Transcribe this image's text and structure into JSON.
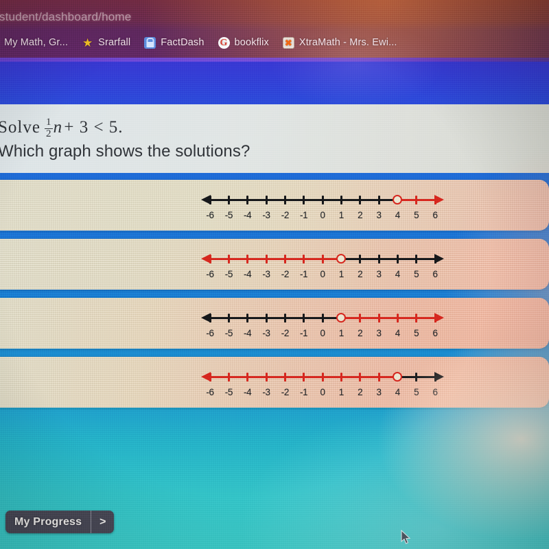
{
  "browser": {
    "url_text": "/student/dashboard/home",
    "bookmarks": [
      {
        "label": "My Math, Gr...",
        "icon": "none"
      },
      {
        "label": "Srarfall",
        "icon": "star-icon"
      },
      {
        "label": "FactDash",
        "icon": "lock-icon"
      },
      {
        "label": "bookflix",
        "icon": "google-g-icon"
      },
      {
        "label": "XtraMath - Mrs. Ewi...",
        "icon": "x-icon"
      }
    ]
  },
  "question": {
    "prefix": "Solve",
    "fraction_numerator": "1",
    "fraction_denominator": "2",
    "variable": "n",
    "rest": "+ 3 < 5.",
    "full_equation": "Solve 1/2 n + 3 < 5.",
    "prompt": "Which graph shows the solutions?"
  },
  "number_line": {
    "min": -6,
    "max": 6,
    "tick_labels": [
      "-6",
      "-5",
      "-4",
      "-3",
      "-2",
      "-1",
      "0",
      "1",
      "2",
      "3",
      "4",
      "5",
      "6"
    ],
    "colors": {
      "black": "#16181b",
      "red": "#d7281f"
    }
  },
  "options": [
    {
      "id": "A",
      "open_circle_at": 4,
      "shaded_direction": "right",
      "shaded_color": "#d7281f",
      "unshaded_color": "#16181b",
      "left_arrow_color": "#16181b",
      "right_arrow_color": "#d7281f"
    },
    {
      "id": "B",
      "open_circle_at": 1,
      "shaded_direction": "left",
      "shaded_color": "#d7281f",
      "unshaded_color": "#16181b",
      "left_arrow_color": "#d7281f",
      "right_arrow_color": "#16181b"
    },
    {
      "id": "C",
      "open_circle_at": 1,
      "shaded_direction": "right",
      "shaded_color": "#d7281f",
      "unshaded_color": "#16181b",
      "left_arrow_color": "#16181b",
      "right_arrow_color": "#d7281f"
    },
    {
      "id": "D",
      "open_circle_at": 4,
      "shaded_direction": "left",
      "shaded_color": "#d7281f",
      "unshaded_color": "#16181b",
      "left_arrow_color": "#d7281f",
      "right_arrow_color": "#16181b"
    }
  ],
  "footer": {
    "my_progress_label": "My Progress",
    "chevron_label": ">"
  },
  "chart_data": {
    "type": "line",
    "title": "Which graph shows the solutions?",
    "xlabel": "",
    "ylabel": "",
    "x": [
      -6,
      -5,
      -4,
      -3,
      -2,
      -1,
      0,
      1,
      2,
      3,
      4,
      5,
      6
    ],
    "xlim": [
      -6,
      6
    ],
    "grid": false,
    "series": [
      {
        "name": "A",
        "open_circle_at": 4,
        "ray": "right",
        "values": [
          0,
          0,
          0,
          0,
          0,
          0,
          0,
          0,
          0,
          0,
          1,
          1,
          1
        ]
      },
      {
        "name": "B",
        "open_circle_at": 1,
        "ray": "left",
        "values": [
          1,
          1,
          1,
          1,
          1,
          1,
          1,
          0,
          0,
          0,
          0,
          0,
          0
        ]
      },
      {
        "name": "C",
        "open_circle_at": 1,
        "ray": "right",
        "values": [
          0,
          0,
          0,
          0,
          0,
          0,
          0,
          0,
          1,
          1,
          1,
          1,
          1
        ]
      },
      {
        "name": "D",
        "open_circle_at": 4,
        "ray": "left",
        "values": [
          1,
          1,
          1,
          1,
          1,
          1,
          1,
          1,
          1,
          1,
          0,
          0,
          0
        ]
      }
    ]
  }
}
